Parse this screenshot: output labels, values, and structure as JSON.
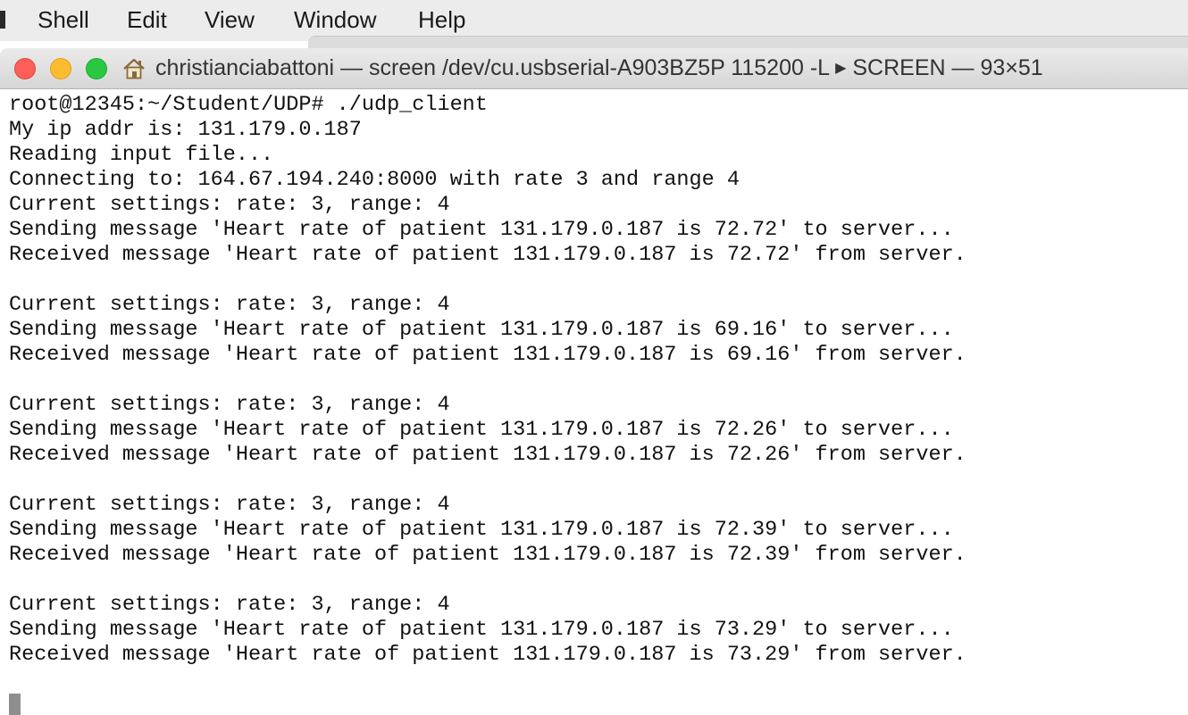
{
  "menubar": {
    "items": [
      "Shell",
      "Edit",
      "View",
      "Window",
      "Help"
    ]
  },
  "window": {
    "title_prefix": "christianciabattoni — screen /dev/cu.usbserial-A903BZ5P 115200 -L",
    "title_arrow": "▶",
    "title_suffix": "SCREEN — 93×51",
    "icons": {
      "home": "home-icon",
      "close": "close-button",
      "minimize": "minimize-button",
      "maximize": "maximize-button"
    },
    "colors": {
      "close": "#fc5f57",
      "minimize": "#fdbc2e",
      "maximize": "#2ac840"
    }
  },
  "terminal": {
    "lines": [
      "root@12345:~/Student/UDP# ./udp_client",
      "My ip addr is: 131.179.0.187",
      "Reading input file...",
      "Connecting to: 164.67.194.240:8000 with rate 3 and range 4",
      "Current settings: rate: 3, range: 4",
      "Sending message 'Heart rate of patient 131.179.0.187 is 72.72' to server...",
      "Received message 'Heart rate of patient 131.179.0.187 is 72.72' from server.",
      "",
      "Current settings: rate: 3, range: 4",
      "Sending message 'Heart rate of patient 131.179.0.187 is 69.16' to server...",
      "Received message 'Heart rate of patient 131.179.0.187 is 69.16' from server.",
      "",
      "Current settings: rate: 3, range: 4",
      "Sending message 'Heart rate of patient 131.179.0.187 is 72.26' to server...",
      "Received message 'Heart rate of patient 131.179.0.187 is 72.26' from server.",
      "",
      "Current settings: rate: 3, range: 4",
      "Sending message 'Heart rate of patient 131.179.0.187 is 72.39' to server...",
      "Received message 'Heart rate of patient 131.179.0.187 is 72.39' from server.",
      "",
      "Current settings: rate: 3, range: 4",
      "Sending message 'Heart rate of patient 131.179.0.187 is 73.29' to server...",
      "Received message 'Heart rate of patient 131.179.0.187 is 73.29' from server.",
      ""
    ]
  }
}
